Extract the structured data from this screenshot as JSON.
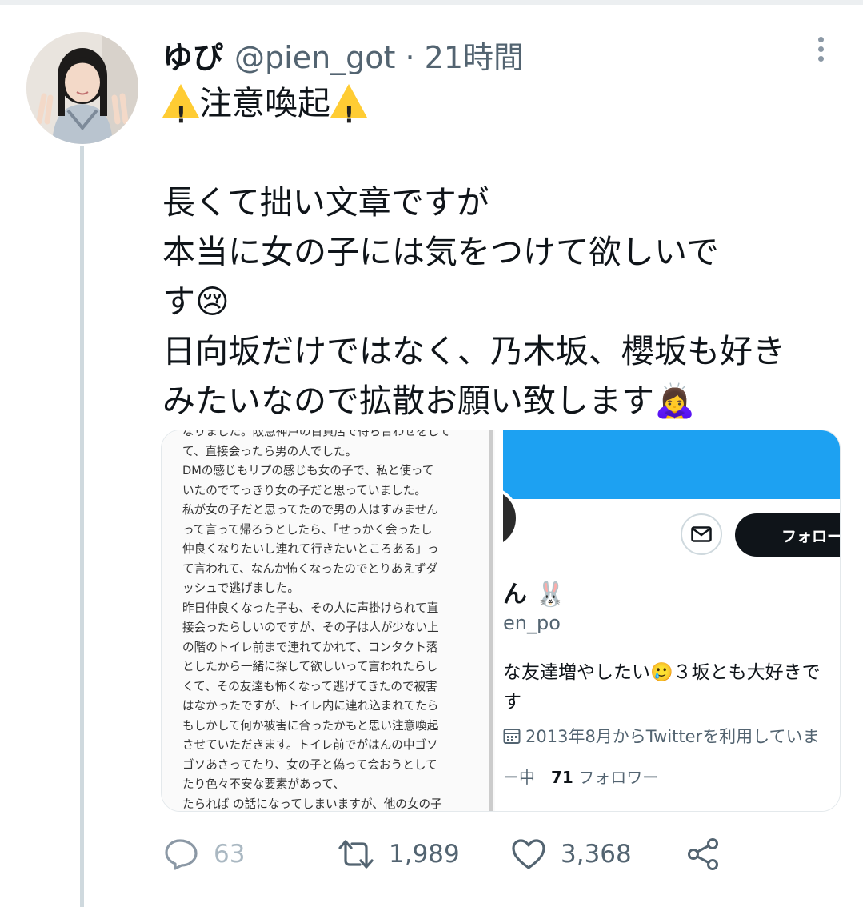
{
  "tweet": {
    "display_name": "ゆぴ",
    "handle_time": "@pien_got · 21時間",
    "title_text": "注意喚起",
    "body": "長くて拙い文章ですが\n本当に女の子には気をつけて欲しいで\nす😢\n日向坂だけではなく、乃木坂、櫻坂も好き\nみたいなので拡散お願い致します🙇‍♀️"
  },
  "media": {
    "document_text": "なりました。阪急神戸の百貨店で待ち合わせをして\nて、直接会ったら男の人でした。\nDMの感じもリプの感じも女の子で、私と使って\nいたのでてっきり女の子だと思っていました。\n私が女の子だと思ってたので男の人はすみません\nって言って帰ろうとしたら、「せっかく会ったし\n仲良くなりたいし連れて行きたいところある」っ\nて言われて、なんか怖くなったのでとりあえずダ\nッシュで逃げました。\n昨日仲良くなった子も、その人に声掛けられて直\n接会ったらしいのですが、その子は人が少ない上\nの階のトイレ前まで連れてかれて、コンタクト落\nとしたから一緒に探して欲しいって言われたらし\nくて、その友達も怖くなって逃げてきたので被害\nはなかったですが、トイレ内に連れ込まれてたら\nもしかして何か被害に合ったかもと思い注意喚起\nさせていただきます。トイレ前でがはんの中ゴソ\nゴソあさってたり、女の子と偽って会おうとして\nたり色々不安な要素があって、\nたられば の話になってしまいますが、他の女の子",
    "profile": {
      "follow_label": "フォロー",
      "name": "ん",
      "handle": "en_po",
      "bio_line1": "な友達増やしたい🥲３坂とも大好きで",
      "bio_line2": "す",
      "joined": "2013年8月からTwitterを利用していま",
      "following_suffix": "ー中",
      "followers_count": "71",
      "followers_label": "フォロワー"
    }
  },
  "actions": {
    "replies": "63",
    "retweets": "1,989",
    "likes": "3,368"
  },
  "colors": {
    "accent": "#1da1f2",
    "text": "#0f1419",
    "muted": "#536471",
    "thread_line": "#cfd9de"
  }
}
